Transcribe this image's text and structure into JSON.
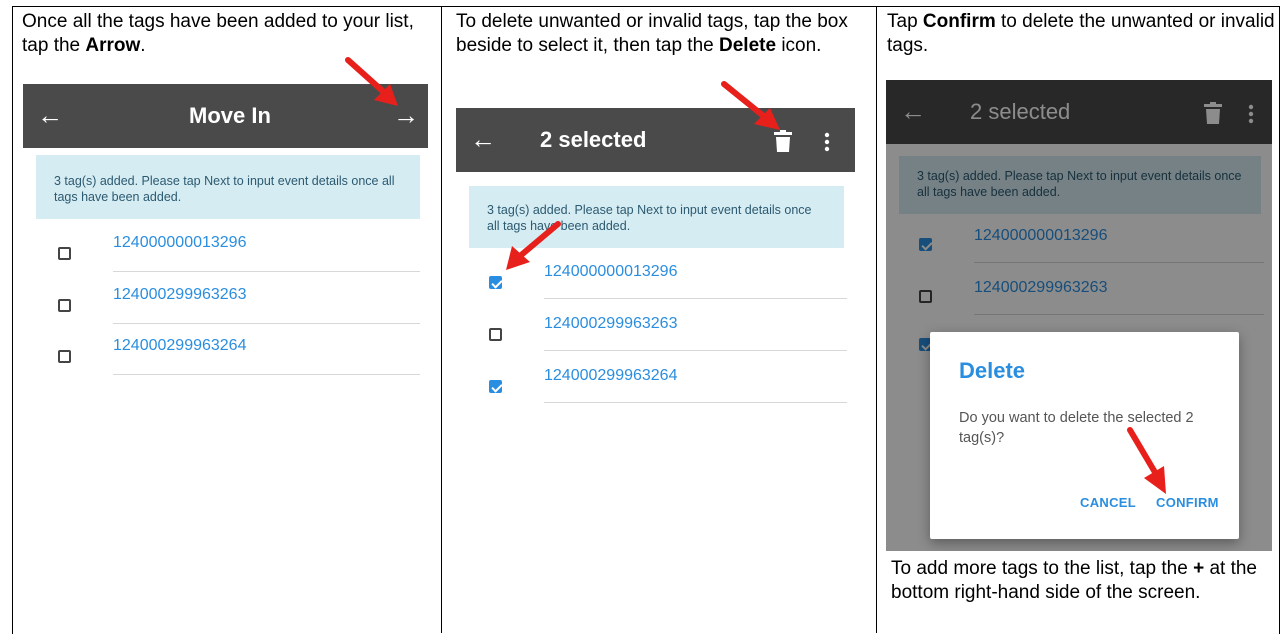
{
  "panels": [
    {
      "instruction_pre": "Once all the tags have been added to your list, tap the ",
      "instruction_bold": "Arrow",
      "instruction_post": ".",
      "screen": {
        "title": "Move In",
        "back_icon": "arrow-left-icon",
        "action_icon": "arrow-right-icon",
        "notice": "3 tag(s) added. Please tap Next to input event details once all tags have been added.",
        "tags": [
          {
            "value": "124000000013296",
            "checked": false
          },
          {
            "value": "124000299963263",
            "checked": false
          },
          {
            "value": "124000299963264",
            "checked": false
          }
        ]
      }
    },
    {
      "instruction_pre": "To delete unwanted or invalid tags, tap the box beside to select it, then tap the ",
      "instruction_bold": "Delete",
      "instruction_post": " icon.",
      "screen": {
        "title": "2 selected",
        "back_icon": "arrow-left-icon",
        "action_icon": "trash-icon",
        "menu_icon": "more-vert-icon",
        "notice": "3 tag(s) added. Please tap Next to input event details once all tags have been added.",
        "tags": [
          {
            "value": "124000000013296",
            "checked": true
          },
          {
            "value": "124000299963263",
            "checked": false
          },
          {
            "value": "124000299963264",
            "checked": true
          }
        ]
      }
    },
    {
      "instruction_pre": "Tap ",
      "instruction_bold": "Confirm",
      "instruction_post": " to delete the unwanted or invalid tags.",
      "screen": {
        "title": "2 selected",
        "back_icon": "arrow-left-icon",
        "action_icon": "trash-icon",
        "menu_icon": "more-vert-icon",
        "notice": "3 tag(s) added. Please tap Next to input event details once all tags have been added.",
        "tags": [
          {
            "value": "124000000013296",
            "checked": true
          },
          {
            "value": "124000299963263",
            "checked": false
          }
        ],
        "dialog": {
          "title": "Delete",
          "body": "Do you want to delete the selected 2 tag(s)?",
          "cancel": "CANCEL",
          "confirm": "CONFIRM"
        }
      },
      "footer_pre": " To add more tags to the list, tap the ",
      "footer_bold": "+",
      "footer_post": " at the bottom right-hand side of the screen."
    }
  ],
  "colors": {
    "appbar": "#4a4a4a",
    "accent": "#2a8ee0",
    "notice_bg": "#d6ecf3",
    "annotation_arrow": "#e8201c"
  }
}
